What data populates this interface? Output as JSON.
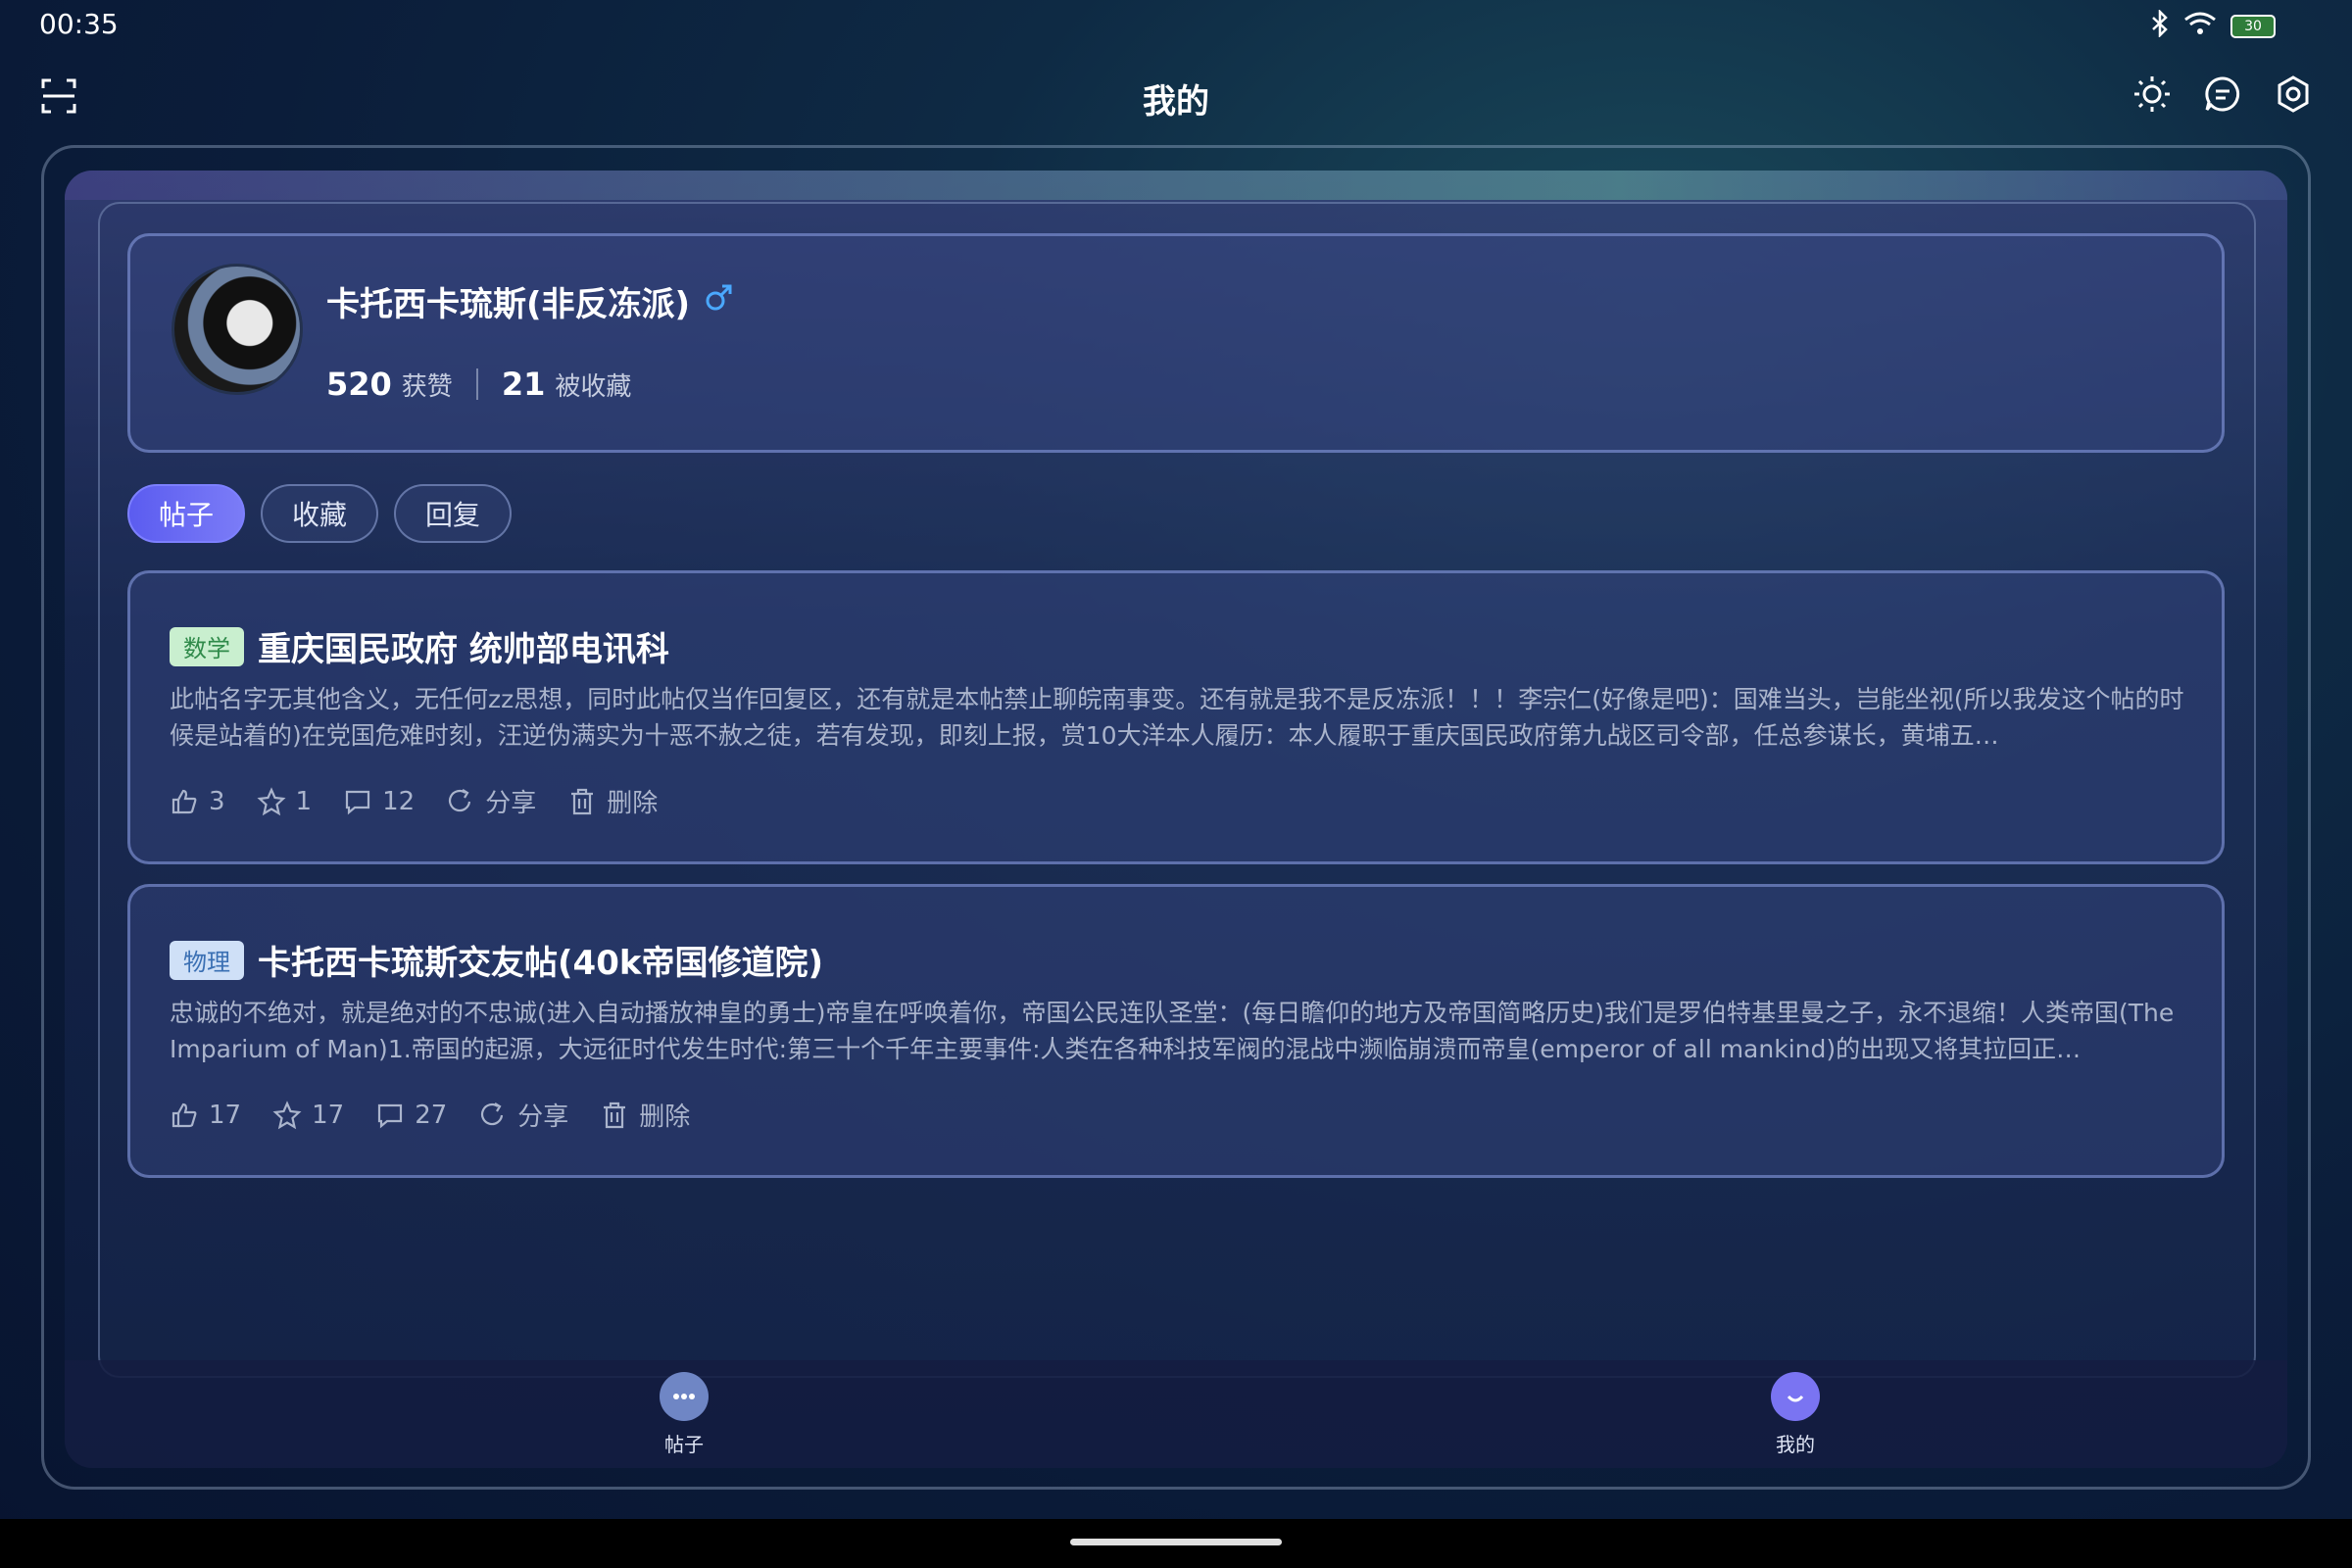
{
  "status": {
    "time": "00:35",
    "battery": "30",
    "icons": [
      "bluetooth-icon",
      "wifi-icon",
      "battery-icon"
    ]
  },
  "header": {
    "title": "我的",
    "left_icon": "scan-icon",
    "right_icons": [
      "theme-icon",
      "message-icon",
      "settings-icon"
    ]
  },
  "profile": {
    "name": "卡托西卡琉斯(非反冻派)",
    "gender_icon": "male-icon",
    "likes_count": "520",
    "likes_label": "获赞",
    "favorites_count": "21",
    "favorites_label": "被收藏"
  },
  "tabs": [
    {
      "label": "帖子",
      "active": true
    },
    {
      "label": "收藏",
      "active": false
    },
    {
      "label": "回复",
      "active": false
    }
  ],
  "posts": [
    {
      "tag": "数学",
      "title": "重庆国民政府 统帅部电讯科",
      "body": "此帖名字无其他含义，无任何zz思想，同时此帖仅当作回复区，还有就是本帖禁止聊皖南事变。还有就是我不是反冻派！！！李宗仁(好像是吧)：国难当头，岂能坐视(所以我发这个帖的时候是站着的)在党国危难时刻，汪逆伪满实为十恶不赦之徒，若有发现，即刻上报，赏10大洋本人履历：本人履职于重庆国民政府第九战区司令部，任总参谋长，黄埔五…",
      "likes": "3",
      "stars": "1",
      "comments": "12",
      "share": "分享",
      "delete": "删除"
    },
    {
      "tag": "物理",
      "title": "卡托西卡琉斯交友帖(40k帝国修道院)",
      "body": "忠诚的不绝对，就是绝对的不忠诚(进入自动播放神皇的勇士)帝皇在呼唤着你，帝国公民连队圣堂：(每日瞻仰的地方及帝国简略历史)我们是罗伯特基里曼之子，永不退缩！人类帝国(The Imparium of Man)1.帝国的起源，大远征时代发生时代:第三十个千年主要事件:人类在各种科技军阀的混战中濒临崩溃而帝皇(emperor of all mankind)的出现又将其拉回正…",
      "likes": "17",
      "stars": "17",
      "comments": "27",
      "share": "分享",
      "delete": "删除"
    }
  ],
  "bottom_nav": [
    {
      "label": "帖子",
      "icon": "chat-bubble-icon"
    },
    {
      "label": "我的",
      "icon": "user-face-icon"
    }
  ]
}
